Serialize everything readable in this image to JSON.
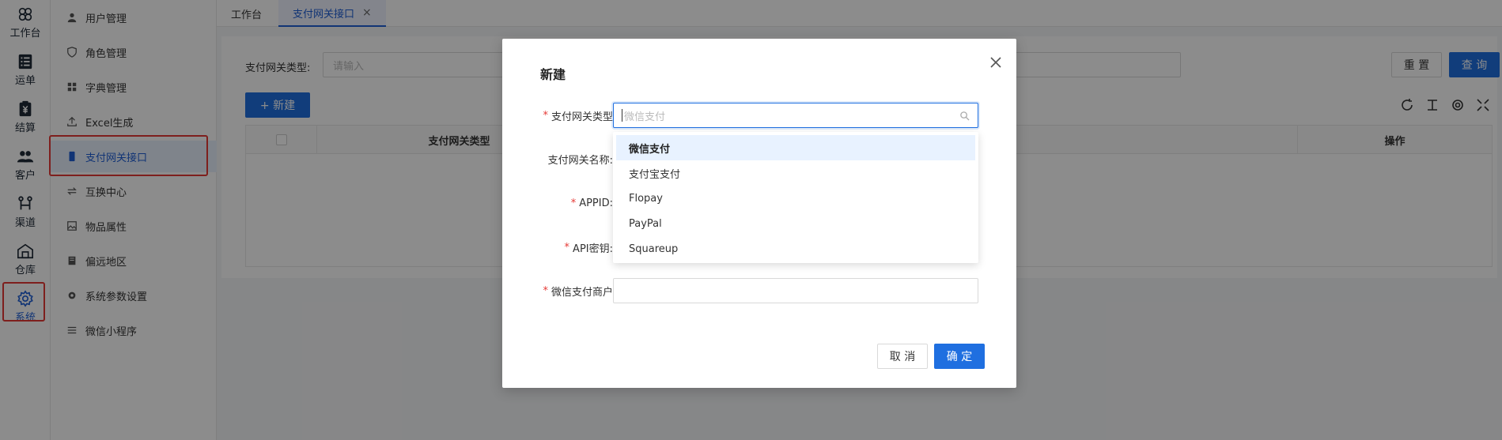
{
  "rail": [
    {
      "name": "workbench",
      "label": "工作台",
      "icon": "clover-icon"
    },
    {
      "name": "waybill",
      "label": "运单",
      "icon": "list-icon"
    },
    {
      "name": "settlement",
      "label": "结算",
      "icon": "yen-clipboard-icon"
    },
    {
      "name": "customer",
      "label": "客户",
      "icon": "users-icon"
    },
    {
      "name": "channel",
      "label": "渠道",
      "icon": "route-icon"
    },
    {
      "name": "warehouse",
      "label": "仓库",
      "icon": "warehouse-icon"
    },
    {
      "name": "system",
      "label": "系统",
      "icon": "gear-icon",
      "active": true
    }
  ],
  "submenu": [
    {
      "label": "用户管理",
      "icon": "user-icon"
    },
    {
      "label": "角色管理",
      "icon": "shield-icon"
    },
    {
      "label": "字典管理",
      "icon": "grid-icon"
    },
    {
      "label": "Excel生成",
      "icon": "upload-icon"
    },
    {
      "label": "支付网关接口",
      "icon": "device-icon",
      "active": true
    },
    {
      "label": "互换中心",
      "icon": "exchange-icon"
    },
    {
      "label": "物品属性",
      "icon": "image-icon"
    },
    {
      "label": "偏远地区",
      "icon": "book-icon"
    },
    {
      "label": "系统参数设置",
      "icon": "gear-icon"
    },
    {
      "label": "微信小程序",
      "icon": "sliders-icon"
    }
  ],
  "tabs": [
    {
      "label": "工作台"
    },
    {
      "label": "支付网关接口",
      "close": "×",
      "active": true
    }
  ],
  "filter": {
    "label": "支付网关类型:",
    "placeholder": "请输入",
    "reset_label": "重 置",
    "search_label": "查 询"
  },
  "toolbar": {
    "new_label": "+ 新建"
  },
  "table": {
    "headers": [
      "",
      "支付网关类型",
      "",
      "操作"
    ]
  },
  "modal": {
    "title": "新建",
    "close": "×",
    "fields": [
      {
        "label": "支付网关类型",
        "required": true,
        "placeholder": "微信支付"
      },
      {
        "label": "支付网关名称:",
        "required": false
      },
      {
        "label": "APPID:",
        "required": true
      },
      {
        "label": "API密钥:",
        "required": true
      },
      {
        "label": "微信支付商户",
        "required": true
      }
    ],
    "dropdown": [
      "微信支付",
      "支付宝支付",
      "Flopay",
      "PayPal",
      "Squareup"
    ],
    "dropdown_selected": 0,
    "cancel_label": "取 消",
    "ok_label": "确 定"
  },
  "colors": {
    "accent": "#1f6fe0",
    "highlight": "#e53935"
  }
}
